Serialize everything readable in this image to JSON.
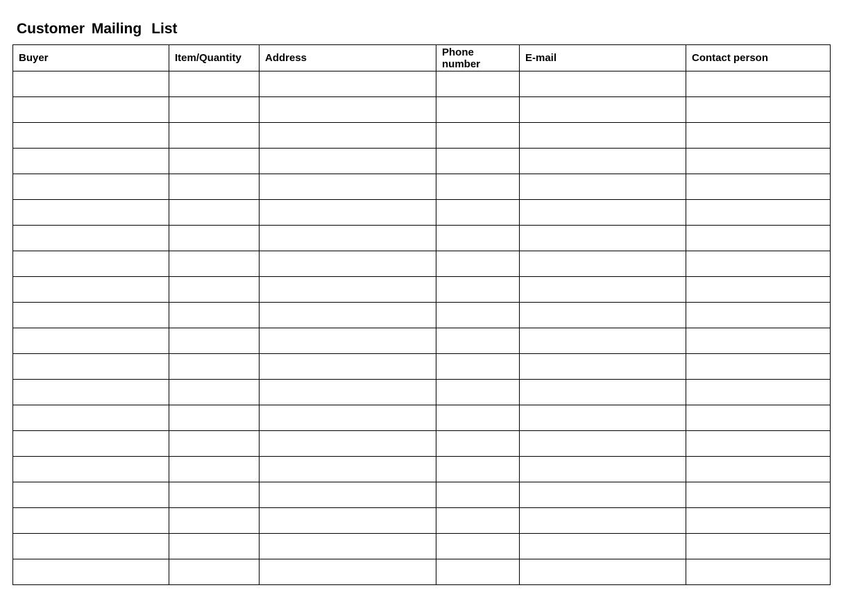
{
  "title_part1": "Customer Mailing",
  "title_part2": "List",
  "columns": [
    "Buyer",
    "Item/Quantity",
    "Address",
    "Phone number",
    "E-mail",
    "Contact person"
  ],
  "rows": [
    [
      "",
      "",
      "",
      "",
      "",
      ""
    ],
    [
      "",
      "",
      "",
      "",
      "",
      ""
    ],
    [
      "",
      "",
      "",
      "",
      "",
      ""
    ],
    [
      "",
      "",
      "",
      "",
      "",
      ""
    ],
    [
      "",
      "",
      "",
      "",
      "",
      ""
    ],
    [
      "",
      "",
      "",
      "",
      "",
      ""
    ],
    [
      "",
      "",
      "",
      "",
      "",
      ""
    ],
    [
      "",
      "",
      "",
      "",
      "",
      ""
    ],
    [
      "",
      "",
      "",
      "",
      "",
      ""
    ],
    [
      "",
      "",
      "",
      "",
      "",
      ""
    ],
    [
      "",
      "",
      "",
      "",
      "",
      ""
    ],
    [
      "",
      "",
      "",
      "",
      "",
      ""
    ],
    [
      "",
      "",
      "",
      "",
      "",
      ""
    ],
    [
      "",
      "",
      "",
      "",
      "",
      ""
    ],
    [
      "",
      "",
      "",
      "",
      "",
      ""
    ],
    [
      "",
      "",
      "",
      "",
      "",
      ""
    ],
    [
      "",
      "",
      "",
      "",
      "",
      ""
    ],
    [
      "",
      "",
      "",
      "",
      "",
      ""
    ],
    [
      "",
      "",
      "",
      "",
      "",
      ""
    ],
    [
      "",
      "",
      "",
      "",
      "",
      ""
    ]
  ]
}
